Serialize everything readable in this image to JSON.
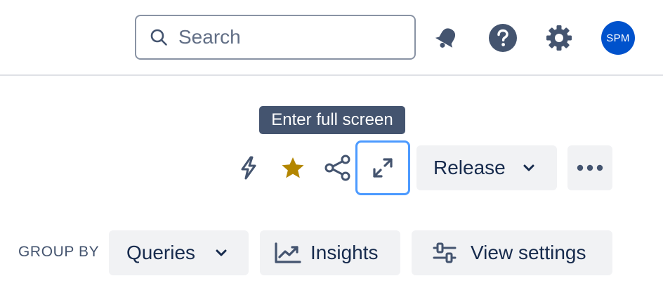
{
  "search": {
    "placeholder": "Search",
    "icon": "search-icon"
  },
  "header": {
    "notifications_icon": "bell-icon",
    "help_icon": "help-icon",
    "settings_icon": "gear-icon",
    "avatar_initials": "SPM",
    "avatar_color": "#0052cc"
  },
  "tooltip": {
    "text": "Enter full screen"
  },
  "toolbar": {
    "automation_icon": "lightning-bolt-icon",
    "star_icon": "star-icon",
    "star_color": "#b38600",
    "share_icon": "share-icon",
    "fullscreen_icon": "expand-icon",
    "release_label": "Release",
    "more_icon": "more-horizontal-icon"
  },
  "group_bar": {
    "label": "GROUP BY",
    "queries_label": "Queries",
    "insights_label": "Insights",
    "view_settings_label": "View settings"
  },
  "colors": {
    "text": "#172b4d",
    "button_bg": "#f1f2f4",
    "focus_ring": "#4c9aff",
    "tooltip_bg": "#44546f"
  }
}
